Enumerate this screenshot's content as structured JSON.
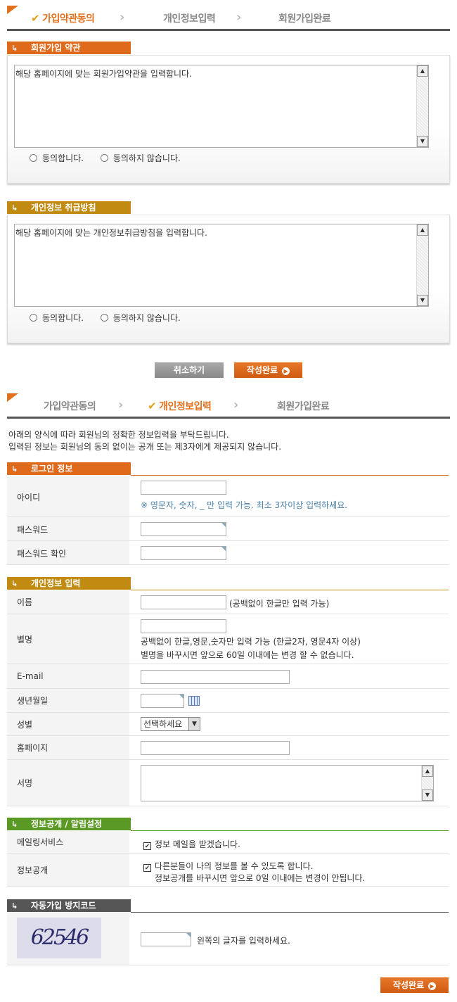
{
  "steps1": {
    "step1": "가입약관동의",
    "step2": "개인정보입력",
    "step3": "회원가입완료"
  },
  "terms": {
    "title": "회원가입 약관",
    "content": "해당 홈페이지에 맞는 회원가입약관을 입력합니다.",
    "agree": "동의합니다.",
    "disagree": "동의하지 않습니다."
  },
  "privacy": {
    "title": "개인정보 취급방침",
    "content": "해당 홈페이지에 맞는 개인정보취급방침을 입력합니다.",
    "agree": "동의합니다.",
    "disagree": "동의하지 않습니다."
  },
  "buttons1": {
    "cancel": "취소하기",
    "submit": "작성완료"
  },
  "steps2": {
    "step1": "가입약관동의",
    "step2": "개인정보입력",
    "step3": "회원가입완료"
  },
  "intro": {
    "line1": "아래의 양식에 따라 회원님의 정확한 정보입력을 부탁드립니다.",
    "line2": "입력된 정보는 회원님의 동의 없이는 공개 또는 제3자에게 제공되지 않습니다."
  },
  "login": {
    "title": "로그인 정보",
    "id_label": "아이디",
    "id_note": "※ 영문자, 숫자, _ 만 입력 가능. 최소 3자이상 입력하세요.",
    "pw_label": "패스워드",
    "pw2_label": "패스워드 확인"
  },
  "personal": {
    "title": "개인정보 입력",
    "name_label": "이름",
    "name_note": "(공백없이 한글만 입력 가능)",
    "nick_label": "별명",
    "nick_note1": "공백없이 한글,영문,숫자만 입력 가능 (한글2자, 영문4자 이상)",
    "nick_note2": "별명을 바꾸시면 앞으로 60일 이내에는 변경 할 수 없습니다.",
    "email_label": "E-mail",
    "birth_label": "생년월일",
    "gender_label": "성별",
    "gender_selected": "선택하세요",
    "homepage_label": "홈페이지",
    "sign_label": "서명"
  },
  "settings": {
    "title": "정보공개 / 알림설정",
    "mailing_label": "메일링서비스",
    "mailing_text": "정보 메일을 받겠습니다.",
    "open_label": "정보공개",
    "open_text": "다른분들이 나의 정보를 볼 수 있도록 합니다.",
    "open_note": "정보공개를 바꾸시면 앞으로 0일 이내에는 변경이 안됩니다."
  },
  "captcha": {
    "title": "자동가입 방지코드",
    "code": "62546",
    "note": "왼쪽의 글자를 입력하세요."
  },
  "buttons2": {
    "submit": "작성완료"
  }
}
